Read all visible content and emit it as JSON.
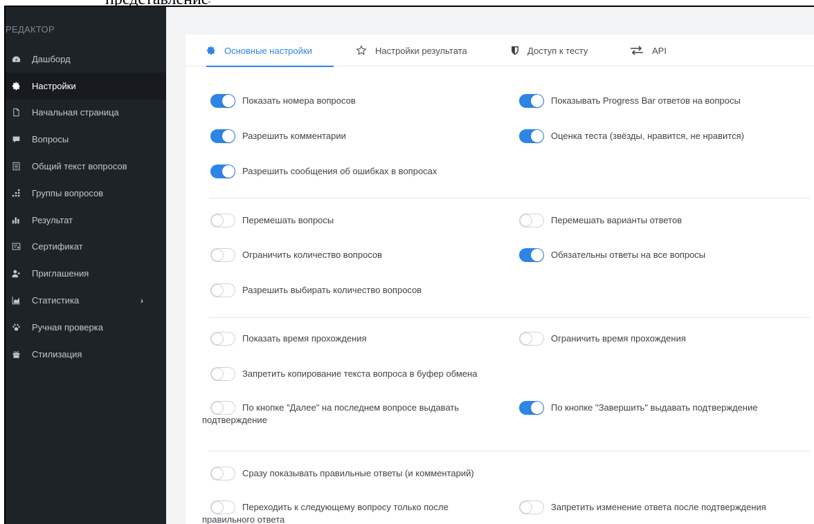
{
  "top_cut_text": "представление",
  "sidebar": {
    "heading": "РЕДАКТОР",
    "items": [
      {
        "label": "Дашборд",
        "icon": "dashboard-icon",
        "active": false
      },
      {
        "label": "Настройки",
        "icon": "gear-icon",
        "active": true
      },
      {
        "label": "Начальная страница",
        "icon": "file-icon",
        "active": false
      },
      {
        "label": "Вопросы",
        "icon": "chat-bubble-icon",
        "active": false
      },
      {
        "label": "Общий текст вопросов",
        "icon": "list-icon",
        "active": false
      },
      {
        "label": "Группы вопросов",
        "icon": "groups-icon",
        "active": false
      },
      {
        "label": "Результат",
        "icon": "bar-chart-icon",
        "active": false
      },
      {
        "label": "Сертификат",
        "icon": "certificate-icon",
        "active": false
      },
      {
        "label": "Приглашения",
        "icon": "user-plus-icon",
        "active": false
      },
      {
        "label": "Статистика",
        "icon": "area-chart-icon",
        "active": false,
        "has_submenu": true
      },
      {
        "label": "Ручная проверка",
        "icon": "paw-icon",
        "active": false
      },
      {
        "label": "Стилизация",
        "icon": "gift-icon",
        "active": false
      }
    ]
  },
  "tabs": [
    {
      "label": "Основные настройки",
      "icon": "gear-icon",
      "active": true
    },
    {
      "label": "Настройки результата",
      "icon": "star-icon",
      "active": false
    },
    {
      "label": "Доступ к тесту",
      "icon": "shield-icon",
      "active": false
    },
    {
      "label": "API",
      "icon": "exchange-icon",
      "active": false
    }
  ],
  "settings": {
    "show_question_numbers": {
      "label": "Показать номера вопросов",
      "on": true
    },
    "show_progress_bar": {
      "label": "Показывать Progress Bar ответов на вопросы",
      "on": true
    },
    "allow_comments": {
      "label": "Разрешить комментарии",
      "on": true
    },
    "test_rating": {
      "label": "Оценка теста (звёзды, нравится, не нравится)",
      "on": true
    },
    "allow_error_reports": {
      "label": "Разрешить сообщения об ошибках в вопросах",
      "on": true
    },
    "shuffle_questions": {
      "label": "Перемешать вопросы",
      "on": false
    },
    "shuffle_answers": {
      "label": "Перемешать варианты ответов",
      "on": false
    },
    "limit_question_count": {
      "label": "Ограничить количество вопросов",
      "on": false
    },
    "require_all_answers": {
      "label": "Обязательны ответы на все вопросы",
      "on": true
    },
    "allow_choose_count": {
      "label": "Разрешить выбирать количество вопросов",
      "on": false
    },
    "show_time": {
      "label": "Показать время прохождения",
      "on": false
    },
    "limit_time": {
      "label": "Ограничить время прохождения",
      "on": false
    },
    "forbid_copy": {
      "label": "Запретить копирование текста вопроса в буфер обмена",
      "on": false
    },
    "next_confirm_line1": {
      "label": "По кнопке \"Далее\" на последнем вопросе выдавать",
      "on": false
    },
    "next_confirm_line2": "подтверждение",
    "finish_confirm": {
      "label": "По кнопке \"Завершить\" выдавать подтверждение",
      "on": true
    },
    "show_correct_answers": {
      "label": "Сразу показывать правильные ответы (и комментарий)",
      "on": false
    },
    "next_after_correct_line1": {
      "label": "Переходить к следующему вопросу только после",
      "on": false
    },
    "next_after_correct_line2": "правильного ответа",
    "forbid_answer_change": {
      "label": "Запретить изменение ответа после подтверждения",
      "on": false
    }
  },
  "colors": {
    "accent": "#2d85e6",
    "sidebar_bg": "#1e2328",
    "content_bg": "#f1f3f5"
  }
}
